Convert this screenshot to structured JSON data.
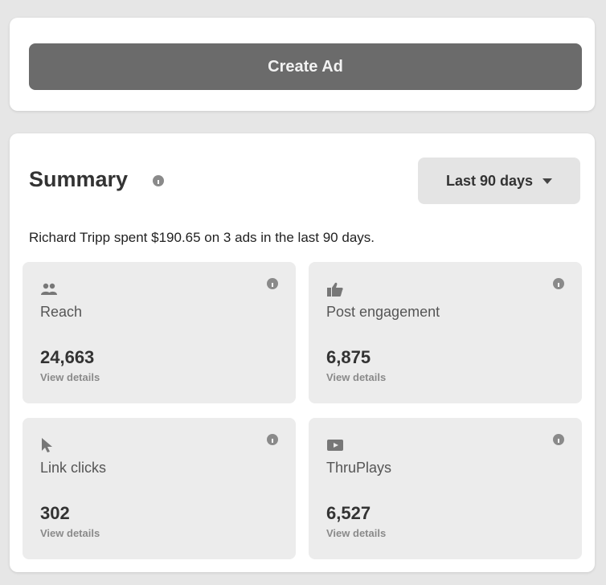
{
  "create_ad": {
    "label": "Create Ad"
  },
  "summary": {
    "title": "Summary",
    "range": {
      "selected": "Last 90 days"
    },
    "sentence": "Richard Tripp spent $190.65 on 3 ads in the last 90 days.",
    "metrics": [
      {
        "icon": "people-icon",
        "label": "Reach",
        "value": "24,663",
        "link": "View details"
      },
      {
        "icon": "thumbs-up-icon",
        "label": "Post engagement",
        "value": "6,875",
        "link": "View details"
      },
      {
        "icon": "cursor-icon",
        "label": "Link clicks",
        "value": "302",
        "link": "View details"
      },
      {
        "icon": "video-icon",
        "label": "ThruPlays",
        "value": "6,527",
        "link": "View details"
      }
    ]
  },
  "colors": {
    "page_bg": "#e6e6e6",
    "card_bg": "#ffffff",
    "button_bg": "#6b6b6b",
    "tile_bg": "#ececec",
    "icon": "#777777"
  }
}
